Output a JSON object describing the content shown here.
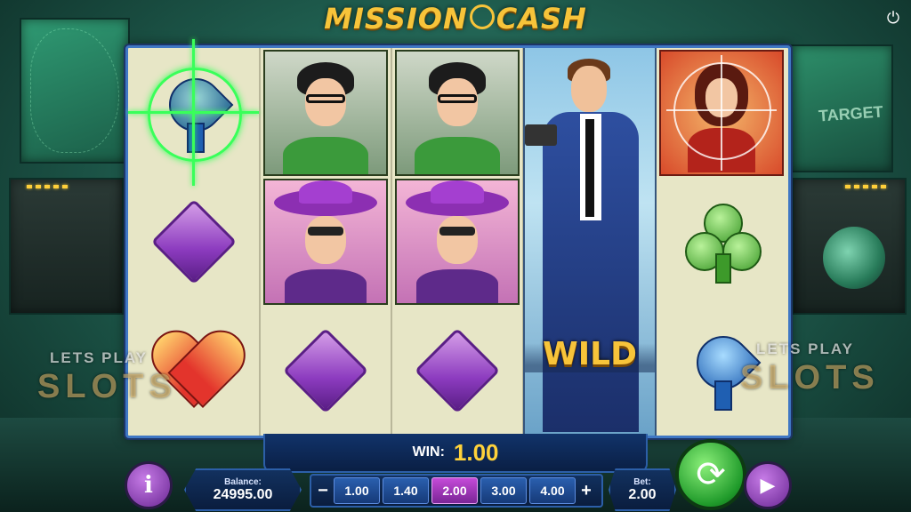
{
  "game": {
    "title": "MISSION CASH",
    "title_left": "MISSION",
    "title_right": "CASH",
    "accent_color": "#f7c43a",
    "scope_color": "#39ff5a"
  },
  "background": {
    "screen_label": "TARGET"
  },
  "reels": {
    "symbols": [
      [
        "spade-target",
        "diamond",
        "heart"
      ],
      [
        "nerd",
        "hat-lady",
        "diamond"
      ],
      [
        "nerd",
        "hat-lady",
        "diamond"
      ],
      [
        "wild-agent",
        "wild-agent",
        "wild-agent"
      ],
      [
        "redhead-target",
        "club",
        "spade"
      ]
    ],
    "wild_label": "WILD"
  },
  "watermark": {
    "line1": "LETS PLAY",
    "line2": "SLOTS"
  },
  "win": {
    "label": "WIN:",
    "value": "1.00"
  },
  "balance": {
    "label": "Balance:",
    "value": "24995.00"
  },
  "bet": {
    "label": "Bet:",
    "value": "2.00",
    "decrease": "−",
    "increase": "+",
    "options": [
      "1.00",
      "1.40",
      "2.00",
      "3.00",
      "4.00"
    ],
    "selected_index": 2
  },
  "buttons": {
    "info": "i",
    "spin_icon": "refresh-icon",
    "play_icon": "play-icon",
    "power_icon": "power-icon"
  }
}
